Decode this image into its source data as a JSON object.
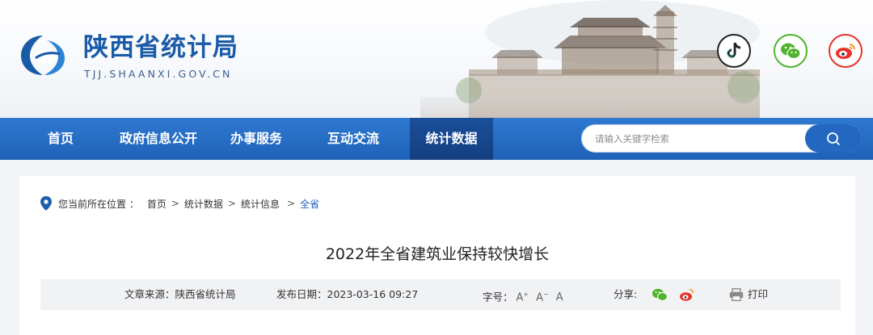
{
  "header": {
    "site_title": "陕西省统计局",
    "site_domain": "TJJ.SHAANXI.GOV.CN",
    "social": [
      "tiktok-icon",
      "wechat-icon",
      "weibo-icon"
    ]
  },
  "nav": {
    "items": [
      {
        "label": "首页"
      },
      {
        "label": "政府信息公开"
      },
      {
        "label": "办事服务"
      },
      {
        "label": "互动交流"
      },
      {
        "label": "统计数据"
      }
    ],
    "active_index": 4
  },
  "search": {
    "placeholder": "请输入关键字检索"
  },
  "breadcrumb": {
    "prefix": "您当前所在位置 ：",
    "items": [
      "首页",
      "统计数据",
      "统计信息"
    ],
    "current": "全省",
    "separator": ">"
  },
  "article": {
    "title": "2022年全省建筑业保持较快增长",
    "source": "文章来源：陕西省统计局",
    "date": "发布日期：2023-03-16 09:27",
    "font_size_label": "字号：",
    "font_large": "A",
    "font_small": "A",
    "font_normal": "A",
    "share_label": "分享:",
    "print_label": "打印"
  },
  "colors": {
    "brand_blue": "#1a5ba8",
    "nav_blue": "#2670c8",
    "nav_active": "#164a92",
    "link_blue": "#2163bd"
  }
}
